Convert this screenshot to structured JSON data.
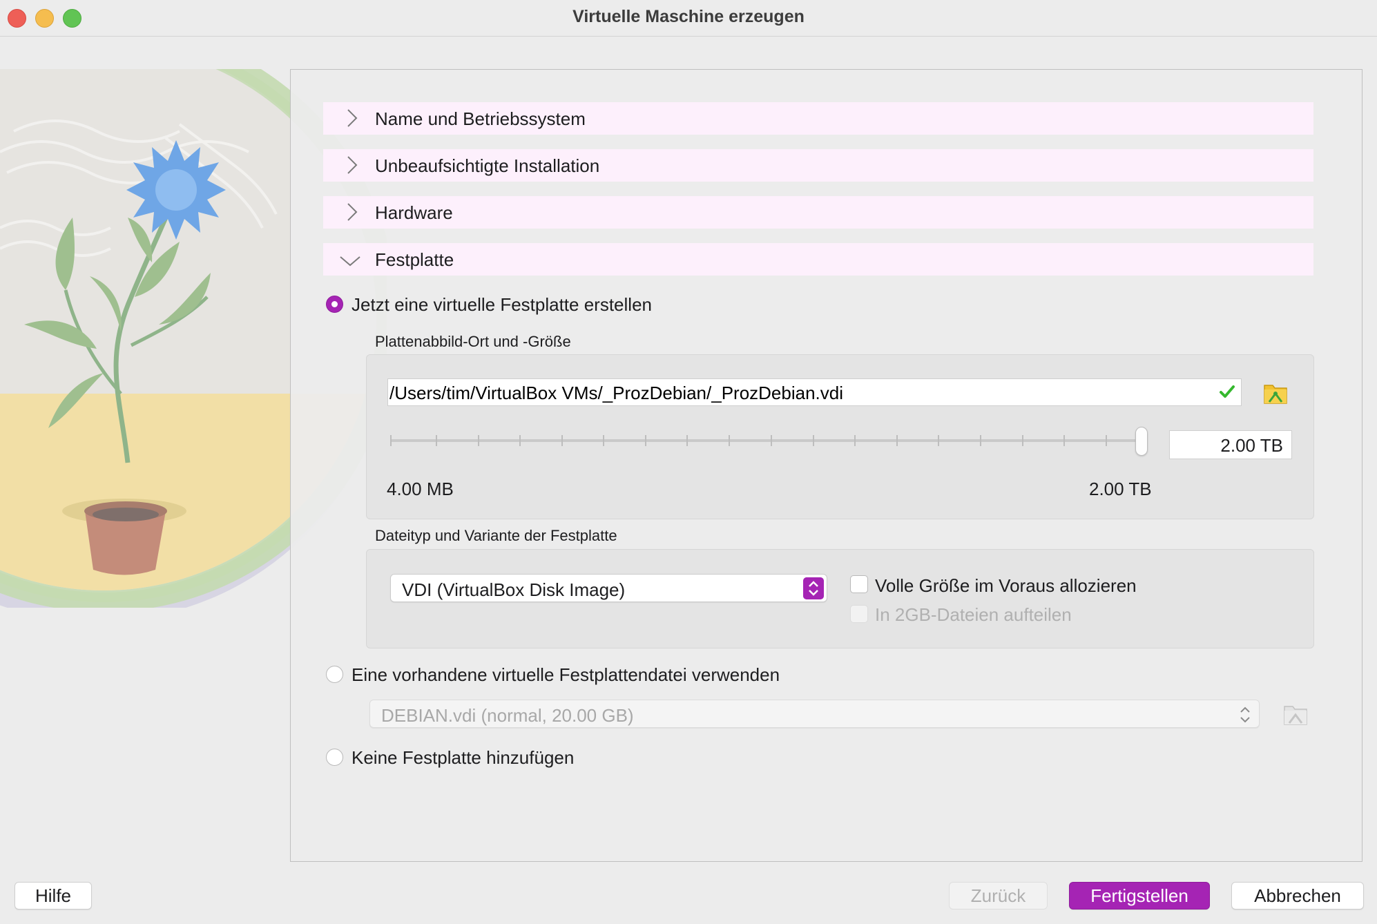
{
  "window": {
    "title": "Virtuelle Maschine erzeugen"
  },
  "sections": [
    {
      "label": "Name und Betriebssystem",
      "expanded": false
    },
    {
      "label": "Unbeaufsichtigte Installation",
      "expanded": false
    },
    {
      "label": "Hardware",
      "expanded": false
    },
    {
      "label": "Festplatte",
      "expanded": true
    }
  ],
  "disk": {
    "option_create": "Jetzt eine virtuelle Festplatte erstellen",
    "location_group_label": "Plattenabbild-Ort und -Größe",
    "path_value": "/Users/tim/VirtualBox VMs/_ProzDebian/_ProzDebian.vdi",
    "size_value": "2.00 TB",
    "slider_min_label": "4.00 MB",
    "slider_max_label": "2.00 TB",
    "slider_level": 1.0,
    "type_group_label": "Dateityp und Variante der Festplatte",
    "type_selected": "VDI (VirtualBox Disk Image)",
    "prealloc_label": "Volle Größe im Voraus allozieren",
    "split_label": "In 2GB-Dateien aufteilen",
    "option_existing": "Eine vorhandene virtuelle Festplattendatei verwenden",
    "existing_selected": "DEBIAN.vdi (normal, 20.00 GB)",
    "option_none": "Keine Festplatte hinzufügen"
  },
  "buttons": {
    "help": "Hilfe",
    "back": "Zurück",
    "finish": "Fertigstellen",
    "cancel": "Abbrechen"
  },
  "colors": {
    "accent": "#a524b4",
    "section_bg": "#fdf0fc",
    "window_bg": "#ececec"
  },
  "icons": [
    "chevron-right-icon",
    "chevron-down-icon",
    "checkmark-icon",
    "folder-icon",
    "select-arrows-icon",
    "flower-illustration"
  ]
}
